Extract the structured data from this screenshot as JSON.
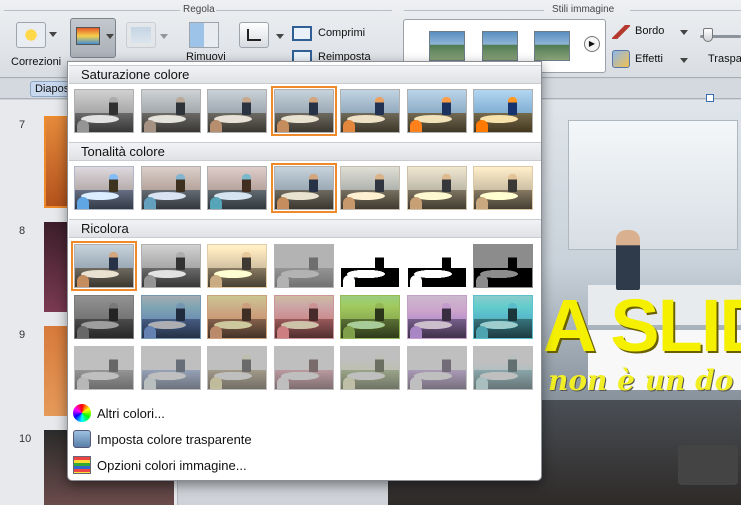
{
  "ribbon": {
    "group_regola": "Regola",
    "group_stili": "Stili immagine",
    "correzioni": "Correzioni",
    "rimuovi": "Rimuovi",
    "comprimi": "Comprimi",
    "reimposta": "Reimposta",
    "bordo": "Bordo",
    "effetti": "Effetti",
    "trasparenza": "Traspa"
  },
  "pane": {
    "tab_label": "Diapos"
  },
  "thumbnails": [
    "7",
    "8",
    "9",
    "10"
  ],
  "slide": {
    "title": "A SLID",
    "subtitle": "non è un do"
  },
  "menu": {
    "section_saturazione": "Saturazione colore",
    "section_tonalita": "Tonalità colore",
    "section_ricolora": "Ricolora",
    "item_altri": "Altri colori...",
    "item_trasparente": "Imposta colore trasparente",
    "item_opzioni": "Opzioni colori immagine..."
  },
  "colors": {
    "selection": "#ef8a2b",
    "title_yellow": "#f5f000"
  }
}
